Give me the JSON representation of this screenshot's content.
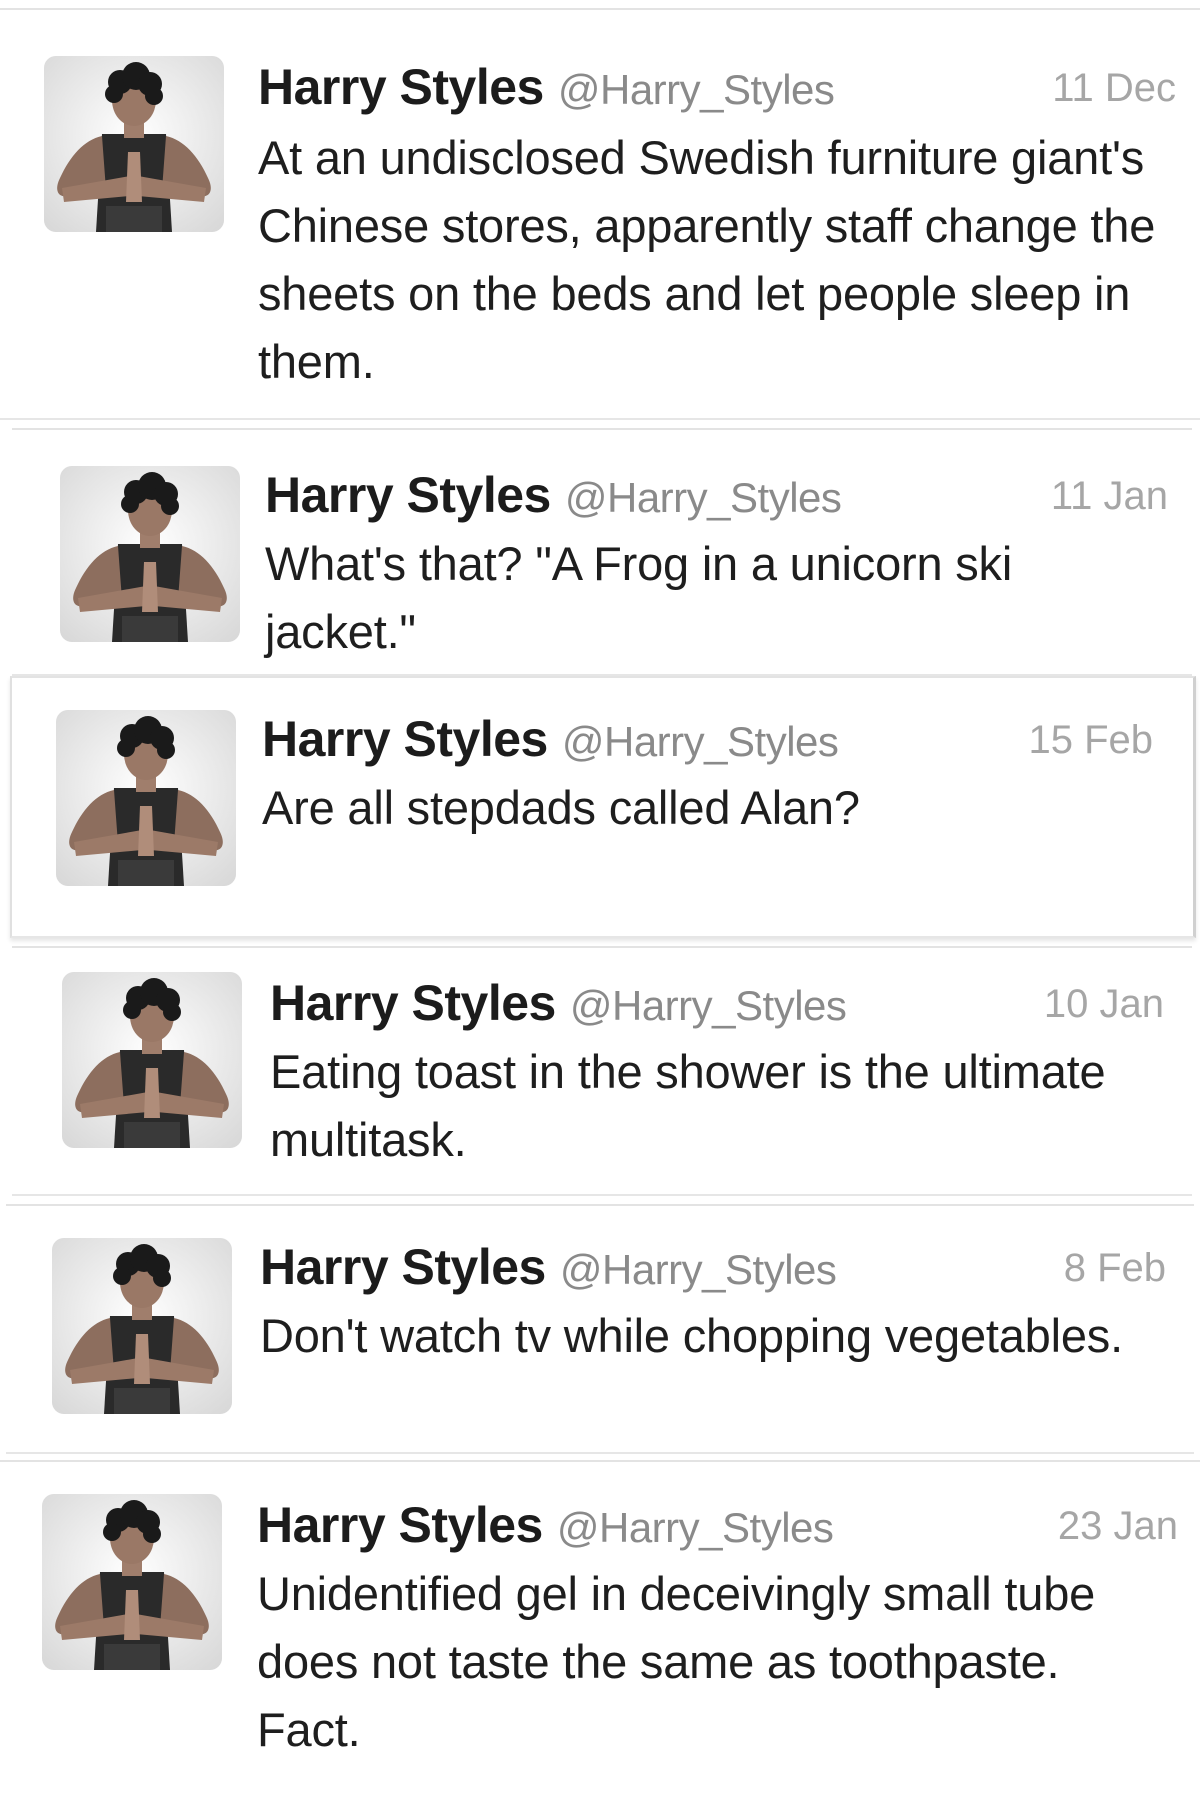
{
  "tweets": [
    {
      "name": "Harry Styles",
      "handle": "@Harry_Styles",
      "date": "11 Dec",
      "text": "At an undisclosed Swedish furniture giant's Chinese stores, apparently staff change the sheets on the beds and let people sleep in them.",
      "avatar_icon": "profile-photo"
    },
    {
      "name": "Harry Styles",
      "handle": "@Harry_Styles",
      "date": "11 Jan",
      "text": "What's that? \"A Frog in a unicorn ski jacket.\"",
      "avatar_icon": "profile-photo"
    },
    {
      "name": "Harry Styles",
      "handle": "@Harry_Styles",
      "date": "15 Feb",
      "text": "Are all stepdads called Alan?",
      "avatar_icon": "profile-photo"
    },
    {
      "name": "Harry Styles",
      "handle": "@Harry_Styles",
      "date": "10 Jan",
      "text": "Eating toast in the shower is the ultimate multitask.",
      "avatar_icon": "profile-photo"
    },
    {
      "name": "Harry Styles",
      "handle": "@Harry_Styles",
      "date": "8 Feb",
      "text": "Don't watch tv while chopping vegetables.",
      "avatar_icon": "profile-photo"
    },
    {
      "name": "Harry Styles",
      "handle": "@Harry_Styles",
      "date": "23 Jan",
      "text": "Unidentified gel in deceivingly small tube does not taste the same as toothpaste. Fact.",
      "avatar_icon": "profile-photo"
    }
  ]
}
